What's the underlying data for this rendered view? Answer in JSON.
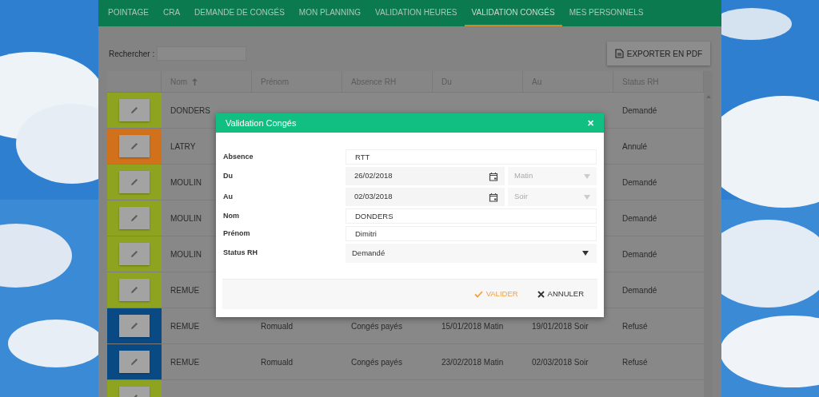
{
  "nav": {
    "items": [
      {
        "label": "POINTAGE",
        "selected": false
      },
      {
        "label": "CRA",
        "selected": false
      },
      {
        "label": "DEMANDE DE CONGÉS",
        "selected": false
      },
      {
        "label": "MON PLANNING",
        "selected": false
      },
      {
        "label": "VALIDATION HEURES",
        "selected": false
      },
      {
        "label": "VALIDATION CONGÉS",
        "selected": true
      },
      {
        "label": "MES PERSONNELS",
        "selected": false
      }
    ]
  },
  "search": {
    "label": "Rechercher :"
  },
  "export_button": {
    "label": "EXPORTER EN PDF"
  },
  "table": {
    "columns": [
      {
        "label": "Nom",
        "sorted": true
      },
      {
        "label": "Prénom",
        "sorted": false
      },
      {
        "label": "Absence RH",
        "sorted": false
      },
      {
        "label": "Du",
        "sorted": false
      },
      {
        "label": "Au",
        "sorted": false
      },
      {
        "label": "Status RH",
        "sorted": false
      }
    ],
    "rows": [
      {
        "color": "#8ea420",
        "cells": [
          "DONDERS",
          null,
          null,
          null,
          null,
          "Demandé"
        ]
      },
      {
        "color": "#d2711b",
        "cells": [
          "LATRY",
          null,
          null,
          null,
          null,
          "Annulé"
        ]
      },
      {
        "color": "#8ea420",
        "cells": [
          "MOULIN",
          null,
          null,
          null,
          null,
          "Demandé"
        ]
      },
      {
        "color": "#8ea420",
        "cells": [
          "MOULIN",
          null,
          null,
          null,
          null,
          "Demandé"
        ]
      },
      {
        "color": "#8ea420",
        "cells": [
          "MOULIN",
          null,
          null,
          null,
          null,
          "Demandé"
        ]
      },
      {
        "color": "#8ea420",
        "cells": [
          "REMUE",
          null,
          null,
          null,
          null,
          "Demandé"
        ]
      },
      {
        "color": "#0a4a84",
        "cells": [
          "REMUE",
          "Romuald",
          "Congés payés",
          "15/01/2018 Matin",
          "19/01/2018 Soir",
          "Refusé"
        ]
      },
      {
        "color": "#0a4a84",
        "cells": [
          "REMUE",
          "Romuald",
          "Congés payés",
          "23/02/2018 Matin",
          "02/03/2018 Soir",
          "Refusé"
        ]
      },
      {
        "color": "#8ea420",
        "cells": [
          null,
          null,
          null,
          null,
          null,
          null
        ]
      }
    ]
  },
  "modal": {
    "title": "Validation Congés",
    "close": "✕",
    "fields": [
      {
        "kind": "text",
        "label": "Absence",
        "value": "RTT"
      },
      {
        "kind": "date",
        "label": "Du",
        "value": "26/02/2018",
        "period": {
          "value": "Matin",
          "disabled": true
        }
      },
      {
        "kind": "date",
        "label": "Au",
        "value": "02/03/2018",
        "period": {
          "value": "Soir",
          "disabled": true
        }
      },
      {
        "kind": "text",
        "label": "Nom",
        "value": "DONDERS"
      },
      {
        "kind": "text",
        "label": "Prénom",
        "value": "Dimitri"
      },
      {
        "kind": "select",
        "label": "Status RH",
        "value": "Demandé"
      }
    ],
    "actions": [
      {
        "kind": "confirm",
        "label": "VALIDER"
      },
      {
        "kind": "cancel",
        "label": "ANNULER"
      }
    ]
  }
}
